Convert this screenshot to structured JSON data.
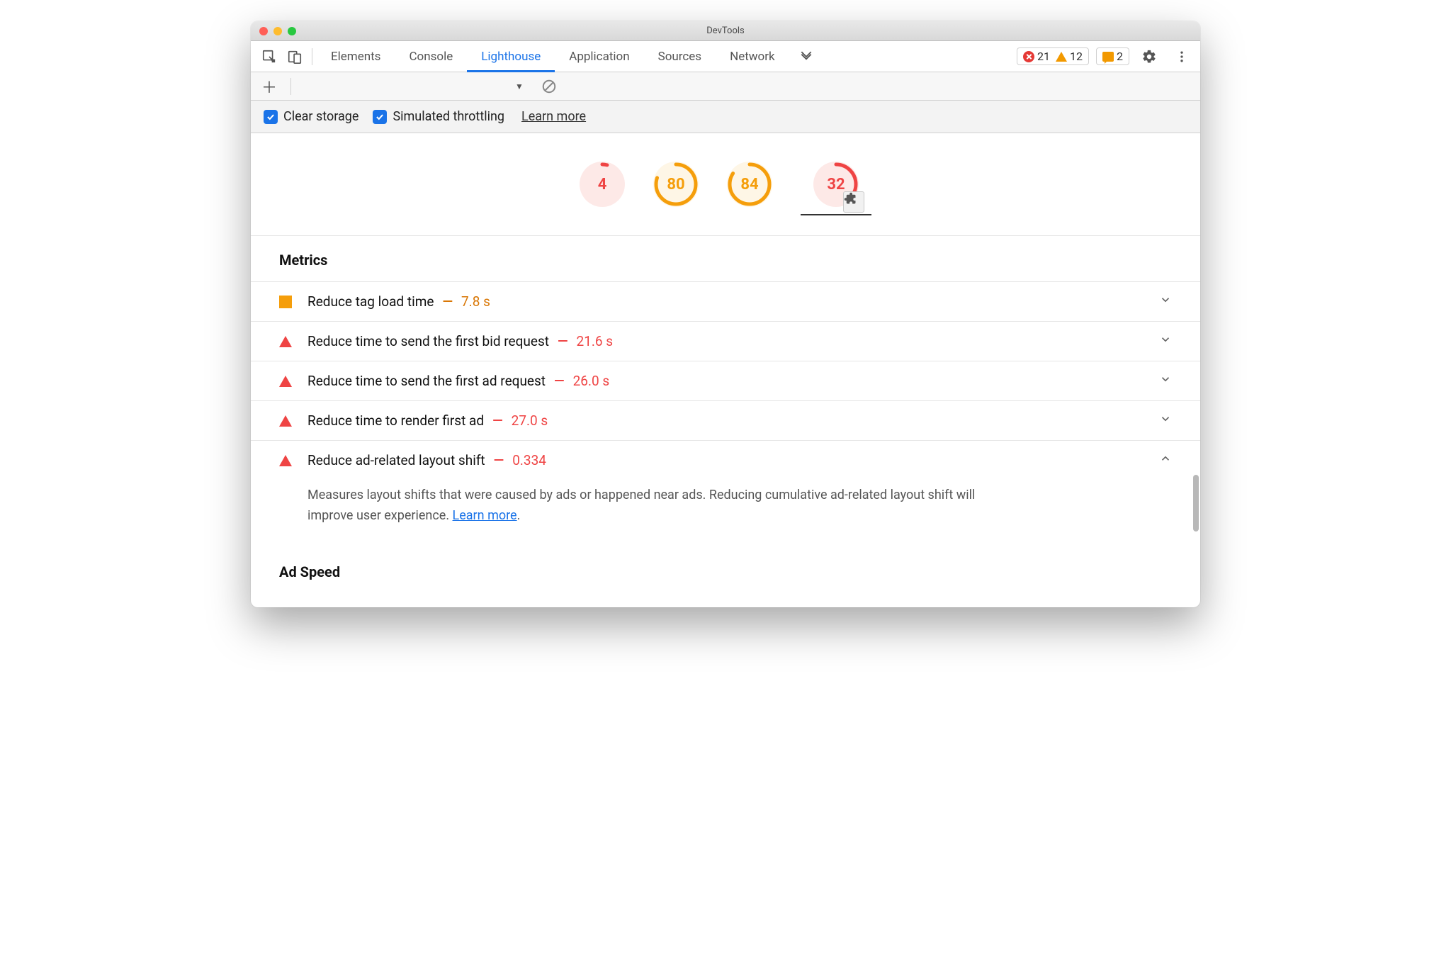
{
  "window": {
    "title": "DevTools"
  },
  "tabs": {
    "items": [
      "Elements",
      "Console",
      "Lighthouse",
      "Application",
      "Sources",
      "Network"
    ],
    "activeIndex": 2
  },
  "badges": {
    "errors": "21",
    "warnings": "12",
    "messages": "2"
  },
  "options": {
    "clearStorage": "Clear storage",
    "simThrottling": "Simulated throttling",
    "learnMore": "Learn more"
  },
  "gaugeScores": [
    {
      "value": "4",
      "pct": 4,
      "status": "red"
    },
    {
      "value": "80",
      "pct": 80,
      "status": "orange"
    },
    {
      "value": "84",
      "pct": 84,
      "status": "orange"
    },
    {
      "value": "32",
      "pct": 32,
      "status": "red",
      "badge": true
    }
  ],
  "sections": {
    "metricsTitle": "Metrics",
    "adSpeedTitle": "Ad Speed"
  },
  "metrics": [
    {
      "icon": "square",
      "label": "Reduce tag load time",
      "value": "7.8 s",
      "color": "orange",
      "open": false
    },
    {
      "icon": "tri",
      "label": "Reduce time to send the first bid request",
      "value": "21.6 s",
      "color": "red",
      "open": false
    },
    {
      "icon": "tri",
      "label": "Reduce time to send the first ad request",
      "value": "26.0 s",
      "color": "red",
      "open": false
    },
    {
      "icon": "tri",
      "label": "Reduce time to render first ad",
      "value": "27.0 s",
      "color": "red",
      "open": false
    },
    {
      "icon": "tri",
      "label": "Reduce ad-related layout shift",
      "value": "0.334",
      "color": "red",
      "open": true,
      "desc": "Measures layout shifts that were caused by ads or happened near ads. Reducing cumulative ad-related layout shift will improve user experience. ",
      "descLink": "Learn more"
    }
  ]
}
